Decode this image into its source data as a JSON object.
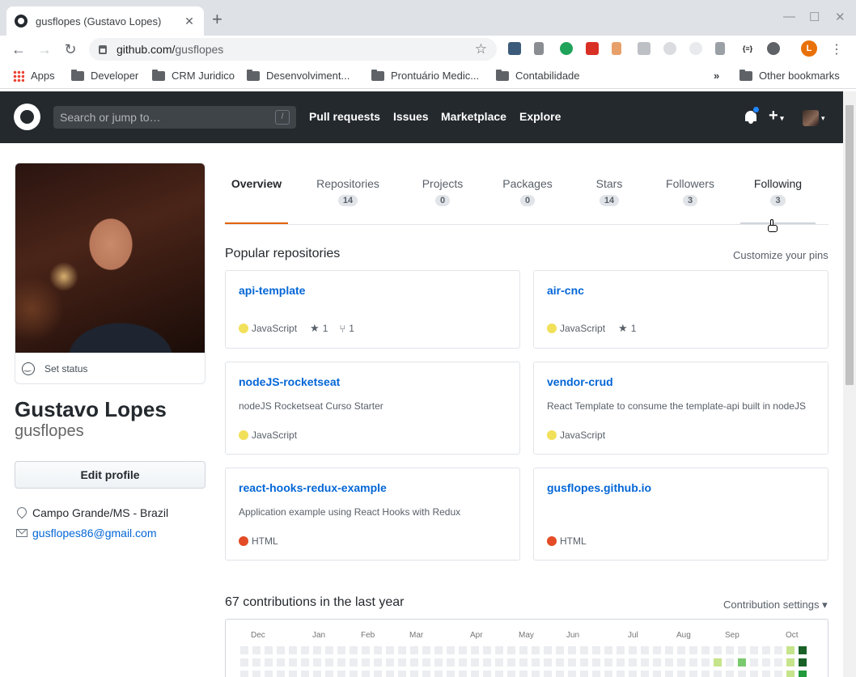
{
  "browser": {
    "tab_title": "gusflopes (Gustavo Lopes)",
    "url_host": "github.com/",
    "url_path": "gusflopes",
    "bookmarks": [
      "Apps",
      "Developer",
      "CRM Juridico",
      "Desenvolviment...",
      "Prontuário Medic...",
      "Contabilidade"
    ],
    "other_bookmarks": "Other bookmarks",
    "profile_initial": "L"
  },
  "header": {
    "search_placeholder": "Search or jump to…",
    "slash": "/",
    "nav": [
      "Pull requests",
      "Issues",
      "Marketplace",
      "Explore"
    ]
  },
  "profile": {
    "set_status": "Set status",
    "full_name": "Gustavo Lopes",
    "username": "gusflopes",
    "edit_profile": "Edit profile",
    "location": "Campo Grande/MS - Brazil",
    "email": "gusflopes86@gmail.com"
  },
  "tabs": [
    {
      "label": "Overview",
      "count": ""
    },
    {
      "label": "Repositories",
      "count": "14"
    },
    {
      "label": "Projects",
      "count": "0"
    },
    {
      "label": "Packages",
      "count": "0"
    },
    {
      "label": "Stars",
      "count": "14"
    },
    {
      "label": "Followers",
      "count": "3"
    },
    {
      "label": "Following",
      "count": "3"
    }
  ],
  "popular": {
    "title": "Popular repositories",
    "customize": "Customize your pins",
    "repos": [
      {
        "name": "api-template",
        "desc": "",
        "lang": "JavaScript",
        "lang_color": "#f1e05a",
        "stars": "1",
        "forks": "1"
      },
      {
        "name": "air-cnc",
        "desc": "",
        "lang": "JavaScript",
        "lang_color": "#f1e05a",
        "stars": "1",
        "forks": ""
      },
      {
        "name": "nodeJS-rocketseat",
        "desc": "nodeJS Rocketseat Curso Starter",
        "lang": "JavaScript",
        "lang_color": "#f1e05a",
        "stars": "",
        "forks": ""
      },
      {
        "name": "vendor-crud",
        "desc": "React Template to consume the template-api built in nodeJS",
        "lang": "JavaScript",
        "lang_color": "#f1e05a",
        "stars": "",
        "forks": ""
      },
      {
        "name": "react-hooks-redux-example",
        "desc": "Application example using React Hooks with Redux",
        "lang": "HTML",
        "lang_color": "#e34c26",
        "stars": "",
        "forks": ""
      },
      {
        "name": "gusflopes.github.io",
        "desc": "",
        "lang": "HTML",
        "lang_color": "#e34c26",
        "stars": "",
        "forks": ""
      }
    ]
  },
  "contributions": {
    "title": "67 contributions in the last year",
    "settings": "Contribution settings",
    "months": [
      "Dec",
      "Jan",
      "Feb",
      "Mar",
      "Apr",
      "May",
      "Jun",
      "Jul",
      "Aug",
      "Sep",
      "Oct"
    ]
  }
}
